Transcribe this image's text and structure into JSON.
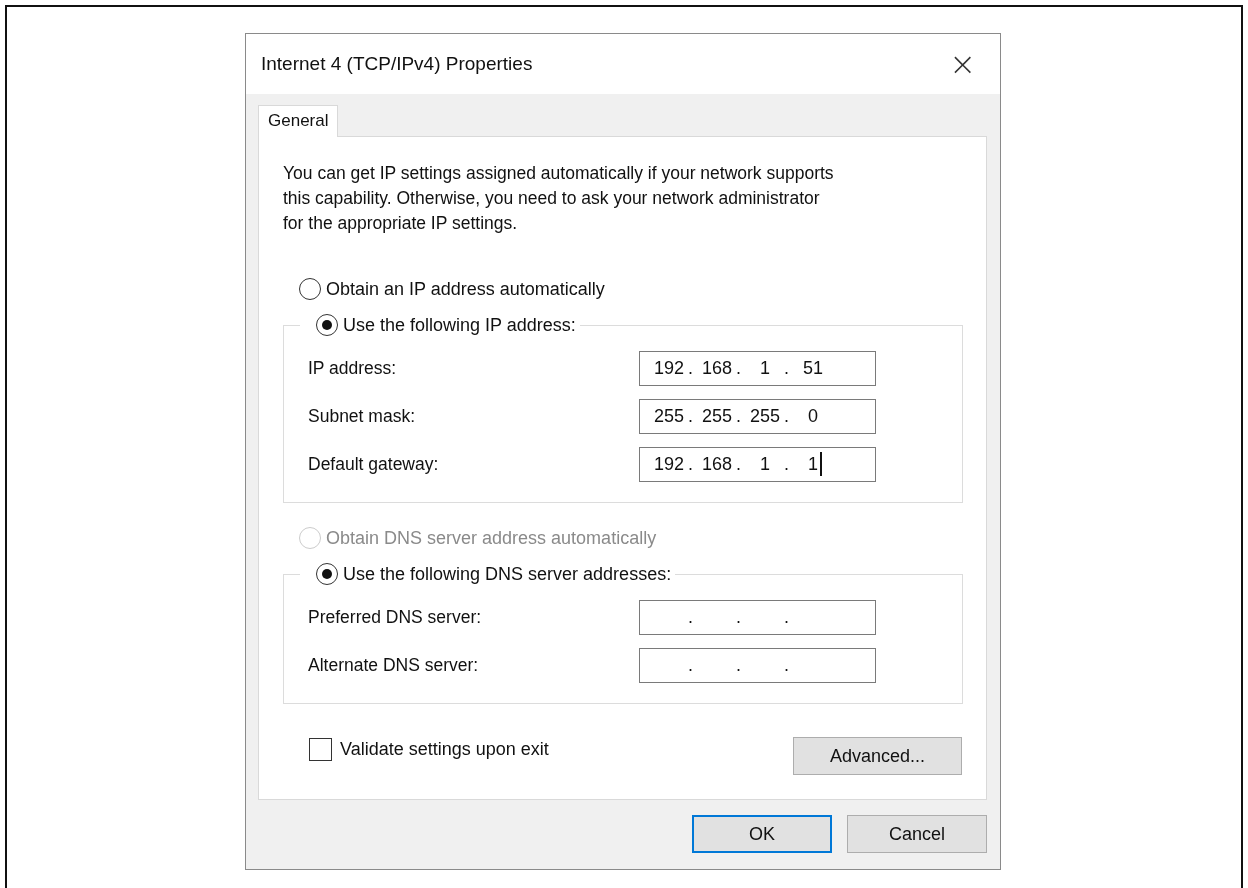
{
  "window": {
    "title": "Internet 4 (TCP/IPv4) Properties",
    "close": "×"
  },
  "tabs": [
    {
      "label": "General",
      "selected": true
    }
  ],
  "intro": "You can get IP settings assigned automatically if your network supports\nthis capability. Otherwise, you need to ask your network administrator\nfor the appropriate IP settings.",
  "ip_section": {
    "options": [
      {
        "label": "Obtain an IP address automatically",
        "selected": false,
        "disabled": false
      },
      {
        "label": "Use the following IP address:",
        "selected": true,
        "disabled": false
      }
    ],
    "fields": [
      {
        "label": "IP address:",
        "focused": false,
        "octets": [
          {
            "value": "192",
            "sep": "."
          },
          {
            "value": "168",
            "sep": "."
          },
          {
            "value": "1",
            "sep": "."
          },
          {
            "value": "51"
          }
        ]
      },
      {
        "label": "Subnet mask:",
        "focused": false,
        "octets": [
          {
            "value": "255",
            "sep": "."
          },
          {
            "value": "255",
            "sep": "."
          },
          {
            "value": "255",
            "sep": "."
          },
          {
            "value": "0"
          }
        ]
      },
      {
        "label": "Default gateway:",
        "focused": true,
        "octets": [
          {
            "value": "192",
            "sep": "."
          },
          {
            "value": "168",
            "sep": "."
          },
          {
            "value": "1",
            "sep": "."
          },
          {
            "value": "1"
          }
        ]
      }
    ]
  },
  "dns_section": {
    "options": [
      {
        "label": "Obtain DNS server address automatically",
        "selected": false,
        "disabled": true
      },
      {
        "label": "Use the following DNS server addresses:",
        "selected": true,
        "disabled": false
      }
    ],
    "fields": [
      {
        "label": "Preferred DNS server:",
        "focused": false,
        "octets": [
          {
            "sep": "."
          },
          {
            "sep": "."
          },
          {
            "sep": "."
          }
        ]
      },
      {
        "label": "Alternate DNS server:",
        "focused": false,
        "octets": [
          {
            "sep": "."
          },
          {
            "sep": "."
          },
          {
            "sep": "."
          }
        ]
      }
    ]
  },
  "validate": {
    "label": "Validate settings upon exit",
    "checked": false
  },
  "advanced_button": "Advanced...",
  "buttons": [
    {
      "label": "OK",
      "default": true
    },
    {
      "label": "Cancel",
      "default": false
    }
  ]
}
